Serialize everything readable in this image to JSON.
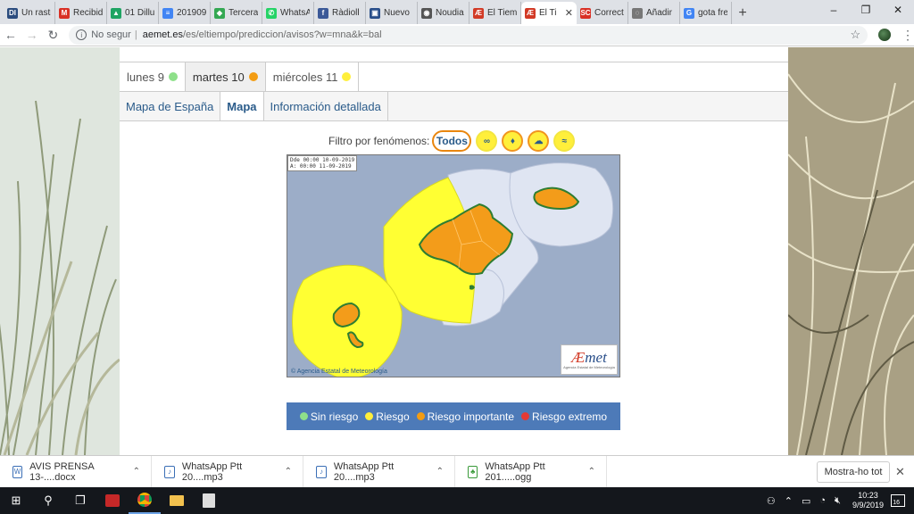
{
  "browser": {
    "tabs": [
      {
        "title": "Un rastr",
        "favicon": "DI",
        "color": "#2b4c7e"
      },
      {
        "title": "Recibido",
        "favicon": "M",
        "color": "#d93025"
      },
      {
        "title": "01 Dillu",
        "favicon": "▲",
        "color": "#1fa463"
      },
      {
        "title": "201909",
        "favicon": "≡",
        "color": "#4285f4"
      },
      {
        "title": "Tercera",
        "favicon": "◆",
        "color": "#34a853"
      },
      {
        "title": "WhatsA",
        "favicon": "✆",
        "color": "#25d366"
      },
      {
        "title": "Ràdioll",
        "favicon": "f",
        "color": "#3b5998"
      },
      {
        "title": "Nuevo",
        "favicon": "▣",
        "color": "#2a4f8a"
      },
      {
        "title": "Noudia",
        "favicon": "◉",
        "color": "#555555"
      },
      {
        "title": "El Tiem",
        "favicon": "Æ",
        "color": "#d23a26"
      },
      {
        "title": "El Ti",
        "favicon": "Æ",
        "color": "#d23a26",
        "active": true
      },
      {
        "title": "Correct",
        "favicon": "SC",
        "color": "#d93025"
      },
      {
        "title": "Añadir",
        "favicon": "◌",
        "color": "#777777"
      },
      {
        "title": "gota fre",
        "favicon": "G",
        "color": "#4285f4"
      }
    ],
    "new_tab_glyph": "+",
    "window_controls": {
      "minimize": "–",
      "restore": "❐",
      "close": "✕"
    },
    "address": {
      "state": "No segur",
      "host": "aemet.es",
      "path": "/es/eltiempo/prediccion/avisos?w=mna&k=bal"
    },
    "icons": {
      "back": "back-arrow-icon",
      "forward": "forward-arrow-icon",
      "reload": "reload-icon",
      "star": "star-icon"
    }
  },
  "page": {
    "day_tabs": [
      {
        "label": "lunes 9",
        "dot": "#8ee08a"
      },
      {
        "label": "martes 10",
        "dot": "#f39c12",
        "selected": true
      },
      {
        "label": "miércoles 11",
        "dot": "#ffef3b"
      }
    ],
    "view_tabs": [
      {
        "label": "Mapa de España"
      },
      {
        "label": "Mapa",
        "selected": true
      },
      {
        "label": "Información detallada"
      }
    ],
    "filter": {
      "label": "Filtro por fenómenos:",
      "todos": "Todos",
      "icons": [
        "waves-icon",
        "rain-drops-icon",
        "storm-icon",
        "wind-icon"
      ]
    },
    "map": {
      "valid_from": "Dde 00:00 10-09-2019",
      "valid_to": "A: 00:00 11-09-2019",
      "copyright": "© Agencia Estatal de Meteorología",
      "logo_text_a": "Æ",
      "logo_text_b": "met",
      "logo_sub": "Agencia Estatal de Meteorología",
      "colors": {
        "sea": "#9cadc8",
        "zone_no_risk": "#dfe5f2",
        "zone_yellow": "#ffff33",
        "zone_orange": "#f39c1a",
        "coast": "#2e7d32"
      }
    },
    "legend": [
      {
        "label": "Sin riesgo",
        "color": "#8ee08a"
      },
      {
        "label": "Riesgo",
        "color": "#ffef3b"
      },
      {
        "label": "Riesgo importante",
        "color": "#f39c12"
      },
      {
        "label": "Riesgo extremo",
        "color": "#e53935"
      }
    ]
  },
  "downloads": {
    "items": [
      {
        "name": "AVIS PRENSA 13-....docx",
        "icon": "word-doc-icon"
      },
      {
        "name": "WhatsApp Ptt 20....mp3",
        "icon": "audio-file-icon"
      },
      {
        "name": "WhatsApp Ptt 20....mp3",
        "icon": "audio-file-icon"
      },
      {
        "name": "WhatsApp Ptt 201.....ogg",
        "icon": "audio-file-icon"
      }
    ],
    "show_all": "Mostra-ho tot"
  },
  "taskbar": {
    "time": "10:23",
    "date": "9/9/2019",
    "notifications": "16"
  }
}
